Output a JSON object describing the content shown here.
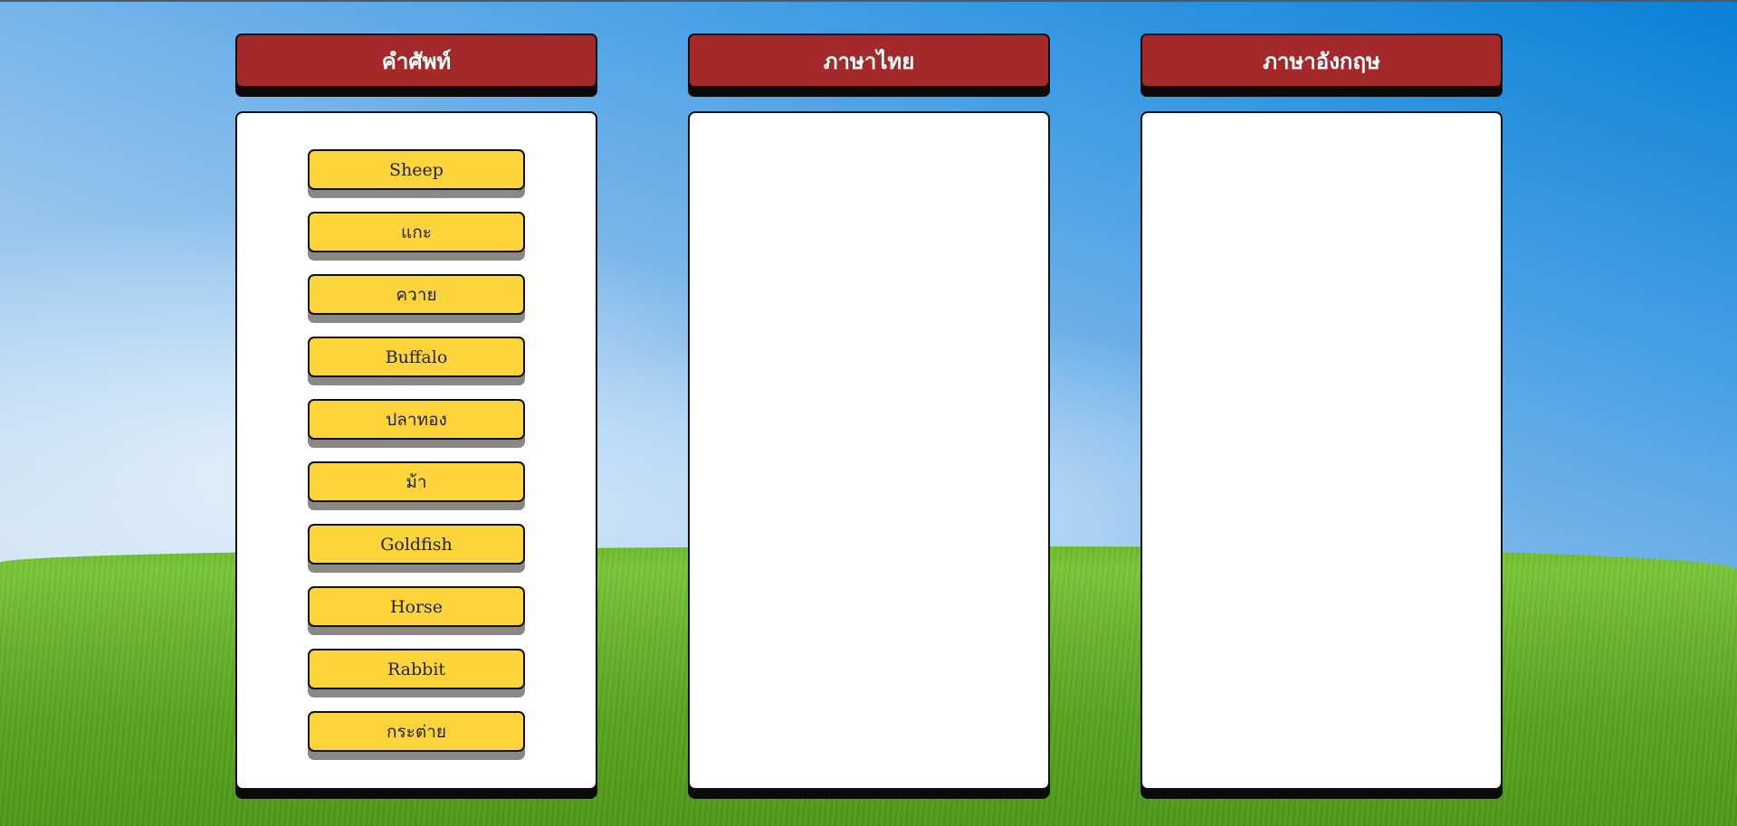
{
  "columns": [
    {
      "id": "words",
      "title": "คำศัพท์"
    },
    {
      "id": "thai",
      "title": "ภาษาไทย"
    },
    {
      "id": "english",
      "title": "ภาษาอังกฤษ"
    }
  ],
  "words": [
    {
      "label": "Sheep",
      "lang": "en"
    },
    {
      "label": "แกะ",
      "lang": "th"
    },
    {
      "label": "ควาย",
      "lang": "th"
    },
    {
      "label": "Buffalo",
      "lang": "en"
    },
    {
      "label": "ปลาทอง",
      "lang": "th"
    },
    {
      "label": "ม้า",
      "lang": "th"
    },
    {
      "label": "Goldfish",
      "lang": "en"
    },
    {
      "label": "Horse",
      "lang": "en"
    },
    {
      "label": "Rabbit",
      "lang": "en"
    },
    {
      "label": "กระต่าย",
      "lang": "th"
    }
  ],
  "colors": {
    "header_bg": "#a4292a",
    "card_bg": "#fdd53a",
    "card_shadow": "#8a8787",
    "panel_bg": "#ffffff"
  }
}
